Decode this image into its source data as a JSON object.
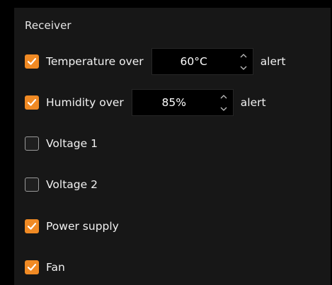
{
  "section": {
    "title": "Receiver"
  },
  "alerts": {
    "temperature": {
      "checked": true,
      "label": "Temperature over",
      "value": "60°C",
      "suffix": "alert"
    },
    "humidity": {
      "checked": true,
      "label": "Humidity over",
      "value": "85%",
      "suffix": "alert"
    },
    "voltage1": {
      "checked": false,
      "label": "Voltage 1"
    },
    "voltage2": {
      "checked": false,
      "label": "Voltage 2"
    },
    "power_supply": {
      "checked": true,
      "label": "Power supply"
    },
    "fan": {
      "checked": true,
      "label": "Fan"
    }
  },
  "icons": {
    "checkbox_checked": "checkmark-icon",
    "spin_up": "chevron-up-icon",
    "spin_down": "chevron-down-icon"
  },
  "colors": {
    "accent": "#f08a24",
    "panel_background": "#171717",
    "page_background": "#000000",
    "text": "#f2f2f2"
  }
}
